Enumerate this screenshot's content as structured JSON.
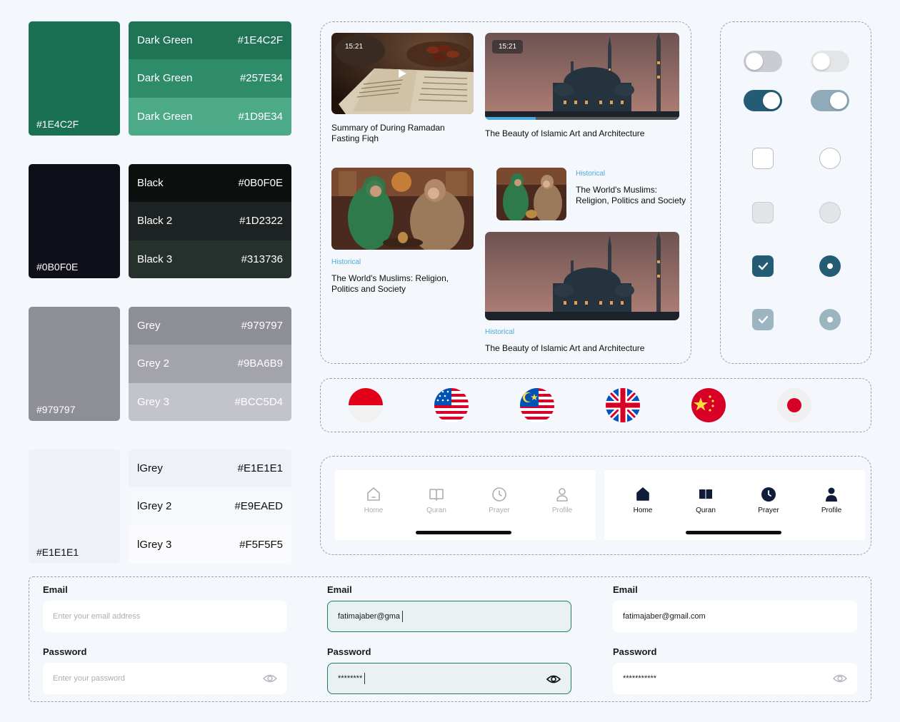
{
  "palette": {
    "green": {
      "main_hex": "#1E4C2F",
      "main_color": "#197052",
      "shades": [
        {
          "name": "Dark Green",
          "hex": "#1E4C2F",
          "color": "#1E7455"
        },
        {
          "name": "Dark Green",
          "hex": "#257E34",
          "color": "#2E8C6A"
        },
        {
          "name": "Dark Green",
          "hex": "#1D9E34",
          "color": "#4DAA88"
        }
      ]
    },
    "black": {
      "main_hex": "#0B0F0E",
      "main_color": "#0F0F1A",
      "shades": [
        {
          "name": "Black",
          "hex": "#0B0F0E",
          "color": "#0B0F0E"
        },
        {
          "name": "Black 2",
          "hex": "#1D2322",
          "color": "#1D2322"
        },
        {
          "name": "Black 3",
          "hex": "#313736",
          "color": "#26312E"
        }
      ]
    },
    "grey": {
      "main_hex": "#979797",
      "main_color": "#8E8E96",
      "shades": [
        {
          "name": "Grey",
          "hex": "#979797",
          "color": "#8E8E96"
        },
        {
          "name": "Grey 2",
          "hex": "#9BA6B9",
          "color": "#A3A3AB"
        },
        {
          "name": "Grey 3",
          "hex": "#BCC5D4",
          "color": "#C2C3CB"
        }
      ]
    },
    "lgrey": {
      "main_hex": "#E1E1E1",
      "main_color": "#EFF1F8",
      "shades": [
        {
          "name": "lGrey",
          "hex": "#E1E1E1",
          "color": "#EFF1F8"
        },
        {
          "name": "lGrey 2",
          "hex": "#E9EAED",
          "color": "#F7F8FB"
        },
        {
          "name": "lGrey 3",
          "hex": "#F5F5F5",
          "color": "#FBFBFD"
        }
      ]
    }
  },
  "videos": [
    {
      "time": "15:21",
      "title": "Summary of During Ramadan Fasting Fiqh"
    },
    {
      "time": "15:21",
      "title": "The Beauty of Islamic Art and Architecture",
      "progress": 0.26
    }
  ],
  "articles": [
    {
      "tag": "Historical",
      "title": "The World's Muslims: Religion, Politics and Society"
    },
    {
      "tag": "Historical",
      "title": "The World's Muslims: Religion, Politics and Society"
    },
    {
      "tag": "Historical",
      "title": "The Beauty of Islamic Art and Architecture"
    }
  ],
  "controls": {
    "toggles": [
      "off",
      "off-disabled",
      "on",
      "on-disabled"
    ],
    "checkbox_states": [
      "unchecked",
      "disabled",
      "checked",
      "checked-disabled"
    ],
    "radio_states": [
      "unchecked",
      "disabled",
      "checked",
      "checked-disabled"
    ],
    "accent_color": "#245B75"
  },
  "flags": [
    "indonesia-flag",
    "usa-flag",
    "malaysia-flag",
    "uk-flag",
    "china-flag",
    "japan-flag"
  ],
  "nav": {
    "inactive": [
      {
        "label": "Home",
        "icon": "home-outline-icon"
      },
      {
        "label": "Quran",
        "icon": "book-outline-icon"
      },
      {
        "label": "Prayer",
        "icon": "clock-outline-icon"
      },
      {
        "label": "Profile",
        "icon": "user-outline-icon"
      }
    ],
    "active": [
      {
        "label": "Home",
        "icon": "home-filled-icon"
      },
      {
        "label": "Quran",
        "icon": "book-filled-icon"
      },
      {
        "label": "Prayer",
        "icon": "clock-filled-icon"
      },
      {
        "label": "Profile",
        "icon": "user-filled-icon"
      }
    ]
  },
  "forms": [
    {
      "email_label": "Email",
      "email_placeholder": "Enter your email address",
      "email_value": "",
      "password_label": "Password",
      "password_placeholder": "Enter your password",
      "password_value": "",
      "state": "empty"
    },
    {
      "email_label": "Email",
      "email_placeholder": "",
      "email_value": "fatimajaber@gma",
      "password_label": "Password",
      "password_placeholder": "",
      "password_value": "********",
      "state": "focused"
    },
    {
      "email_label": "Email",
      "email_placeholder": "",
      "email_value": "fatimajaber@gmail.com",
      "password_label": "Password",
      "password_placeholder": "",
      "password_value": "***********",
      "state": "filled"
    }
  ]
}
